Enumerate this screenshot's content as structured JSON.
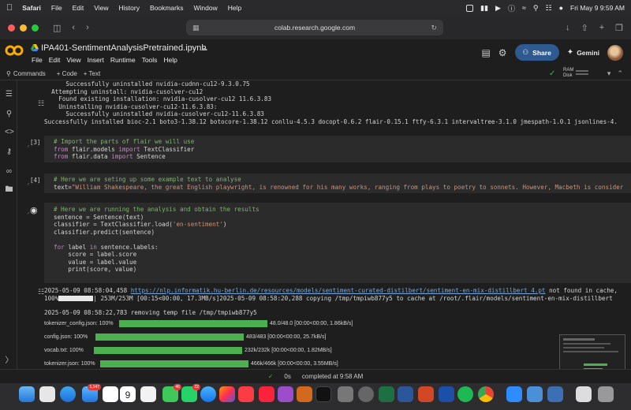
{
  "menubar": {
    "items": [
      "Safari",
      "File",
      "Edit",
      "View",
      "History",
      "Bookmarks",
      "Window",
      "Help"
    ],
    "clock": "Fri May 9  9:59 AM"
  },
  "safari": {
    "url": "colab.research.google.com"
  },
  "colab": {
    "title": "IPA401-SentimentAnalysisPretrained.ipynb",
    "menu": [
      "File",
      "Edit",
      "View",
      "Insert",
      "Runtime",
      "Tools",
      "Help"
    ],
    "share_label": "Share",
    "gemini_label": "Gemini",
    "toolbar": {
      "commands": "Commands",
      "add_code": "+ Code",
      "add_text": "+ Text",
      "ram": "RAM",
      "disk": "Disk"
    }
  },
  "cells": {
    "install_output": [
      "      Successfully uninstalled nvidia-cudnn-cu12-9.3.0.75",
      "  Attempting uninstall: nvidia-cusolver-cu12",
      "    Found existing installation: nvidia-cusolver-cu12 11.6.3.83",
      "    Uninstalling nvidia-cusolver-cu12-11.6.3.83:",
      "      Successfully uninstalled nvidia-cusolver-cu12-11.6.3.83",
      "Successfully installed bioc-2.1 boto3-1.38.12 botocore-1.38.12 conllu-4.5.3 docopt-0.6.2 flair-0.15.1 ftfy-6.3.1 intervaltree-3.1.0 jmespath-1.0.1 jsonlines-4."
    ],
    "cell3": {
      "num": "[3]",
      "comment": "# Import the parts of flair we will use",
      "line1_kw1": "from",
      "line1_mod": " flair.models ",
      "line1_kw2": "import",
      "line1_name": " TextClassifier",
      "line2_kw1": "from",
      "line2_mod": " flair.data ",
      "line2_kw2": "import",
      "line2_name": " Sentence"
    },
    "cell4": {
      "num": "[4]",
      "comment": "# Here we are seting up some example text to analyse",
      "code_prefix": "text=",
      "code_str": "\"William Shakespeare, the great English playwright, is renowned for his many works, ranging from plays to poetry to sonnets. However, Macbeth is consider"
    },
    "cell5": {
      "comment": "# Here we are running the analysis and obtain the results",
      "line1": "sentence = Sentence(text)",
      "line2_a": "classifier = TextClassifier.load(",
      "line2_str": "'en-sentiment'",
      "line2_b": ")",
      "line3": "classifier.predict(sentence)",
      "line4_kw1": "for",
      "line4_mid": " label ",
      "line4_kw2": "in",
      "line4_end": " sentence.labels:",
      "line5": "    score = label.score",
      "line6": "    value = label.value",
      "line7": "    print(score, value)"
    },
    "cell5_output": {
      "line1_pre": "2025-05-09 08:58:04,458 ",
      "line1_url": "https://nlp.informatik.hu-berlin.de/resources/models/sentiment-curated-distilbert/sentiment-en-mix-distillbert_4.pt",
      "line1_post": " not found in cache,",
      "line2_pct": "100%",
      "line2_rest": "| 253M/253M [00:15<00:00, 17.3MB/s]2025-05-09 08:58:20,288 copying /tmp/tmpiwb877y5 to cache at /root/.flair/models/sentiment-en-mix-distillbert",
      "line3": "2025-05-09 08:58:22,783 removing temp file /tmp/tmpiwb877y5",
      "progress": [
        {
          "file": "tokenizer_config.json: 100%",
          "value": 1.0,
          "stats": "48.0/48.0 [00:00<00:00, 1.86kB/s]"
        },
        {
          "file": "config.json: 100%",
          "value": 1.0,
          "stats": "483/483 [00:00<00:00, 25.7kB/s]"
        },
        {
          "file": "vocab.txt: 100%",
          "value": 1.0,
          "stats": "232k/232k [00:00<00:00, 1.82MB/s]"
        },
        {
          "file": "tokenizer.json: 100%",
          "value": 1.0,
          "stats": "466k/466k [00:00<00:00, 3.55MB/s]"
        }
      ]
    }
  },
  "statusbar": {
    "elapsed": "0s",
    "message": "completed at 9:58 AM"
  },
  "dock": {
    "mail_badge": "1,147",
    "calendar_day": "9",
    "messages_badge": "46",
    "whatsapp_badge": "22"
  }
}
